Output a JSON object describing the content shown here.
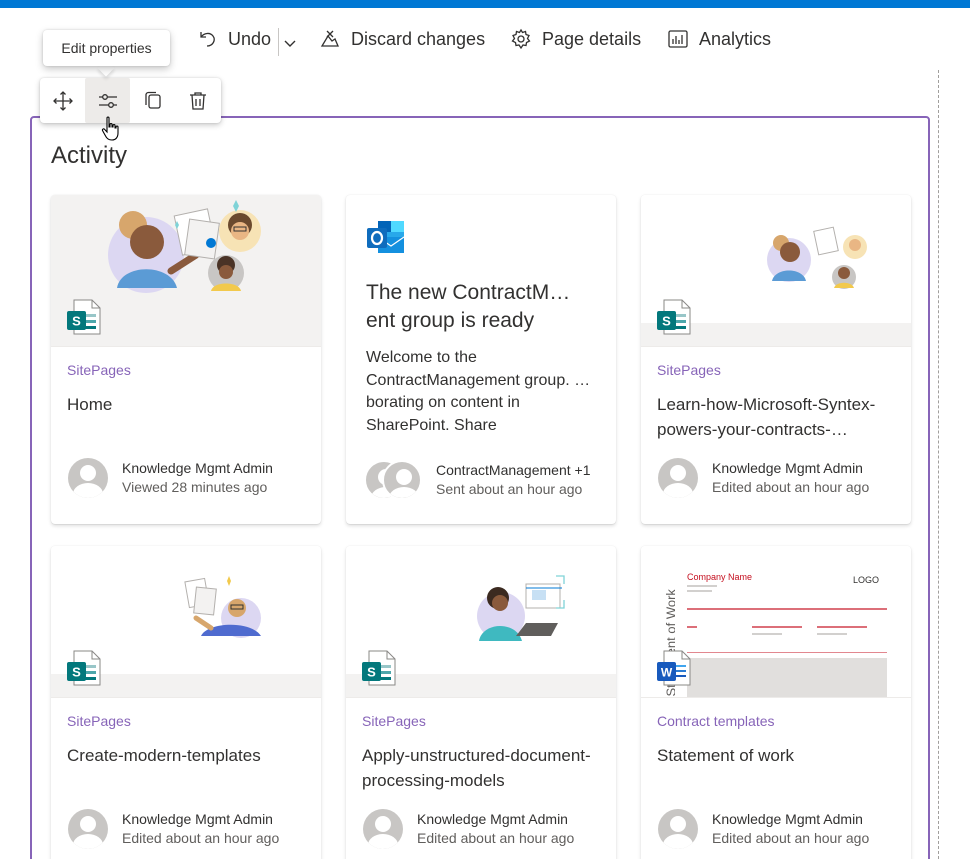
{
  "command_bar": {
    "undo_label": "Undo",
    "discard_label": "Discard changes",
    "page_details_label": "Page details",
    "analytics_label": "Analytics"
  },
  "tooltip": {
    "text": "Edit properties"
  },
  "webpart": {
    "title": "Activity"
  },
  "cards": [
    {
      "category": "SitePages",
      "title": "Home",
      "person": "Knowledge Mgmt Admin",
      "meta": "Viewed 28 minutes ago"
    },
    {
      "headline": "The new ContractM… ent group is ready",
      "body": "Welcome to the ContractManagement group. …borating on content in SharePoint. Share",
      "person": "ContractManagement +1",
      "meta": "Sent about an hour ago"
    },
    {
      "category": "SitePages",
      "title": "Learn-how-Microsoft-Syntex-powers-your-contracts-…",
      "person": "Knowledge Mgmt Admin",
      "meta": "Edited about an hour ago"
    },
    {
      "category": "SitePages",
      "title": "Create-modern-templates",
      "person": "Knowledge Mgmt Admin",
      "meta": "Edited about an hour ago"
    },
    {
      "category": "SitePages",
      "title": "Apply-unstructured-document-processing-models",
      "person": "Knowledge Mgmt Admin",
      "meta": "Edited about an hour ago"
    },
    {
      "category": "Contract templates",
      "title": "Statement of work",
      "person": "Knowledge Mgmt Admin",
      "meta": "Edited about an hour ago"
    }
  ],
  "sow_preview": {
    "company": "Company Name",
    "logo": "LOGO",
    "side_text": "Statement of Work"
  },
  "colors": {
    "accent": "#8764b8",
    "top_bar": "#0078d4",
    "sharepoint": "#03787c",
    "word": "#185abd",
    "outlook": "#0f6cbd"
  }
}
